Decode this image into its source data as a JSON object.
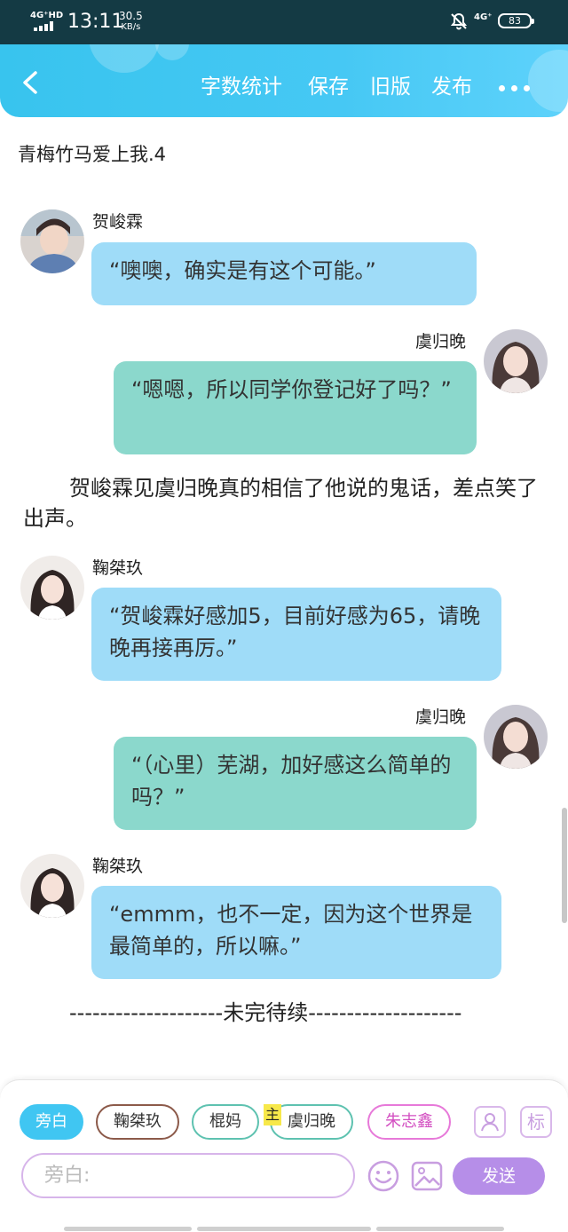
{
  "status_bar": {
    "signal_label": "4G⁺HD",
    "time": "13:11",
    "net_speed_value": "30.5",
    "net_speed_unit": "KB/s",
    "network_right": "4G⁺",
    "battery": "83"
  },
  "header": {
    "actions": [
      "字数统计",
      "保存",
      "旧版",
      "发布"
    ]
  },
  "chapter_title": "青梅竹马爱上我.4",
  "messages": [
    {
      "speaker": "贺峻霖",
      "text": "“噢噢，确实是有这个可能。”"
    },
    {
      "speaker": "虞归晚",
      "text": "“嗯嗯，所以同学你登记好了吗？”"
    },
    {
      "narration": "贺峻霖见虞归晚真的相信了他说的鬼话，差点笑了出声。"
    },
    {
      "speaker": "鞠桀玖",
      "text": "“贺峻霖好感加5，目前好感为65，请晚晚再接再厉。”"
    },
    {
      "speaker": "虞归晚",
      "text": "“（心里）芜湖，加好感这么简单的吗？”"
    },
    {
      "speaker": "鞠桀玖",
      "text": "“emmm，也不一定，因为这个世界是最简单的，所以嘛。”"
    },
    {
      "narration": "--------------------未完待续--------------------"
    }
  ],
  "composer": {
    "roles": [
      "旁白",
      "鞠桀玖",
      "棍妈",
      "虞归晚",
      "朱志鑫"
    ],
    "protagonist_badge": "主",
    "tag_icon_label": "标",
    "input_placeholder": "旁白:",
    "send_label": "发送"
  },
  "colors": {
    "header": "#43c6f2",
    "bubble_left": "#9fdcf8",
    "bubble_right": "#8bd8cc",
    "send": "#b68ee8"
  }
}
